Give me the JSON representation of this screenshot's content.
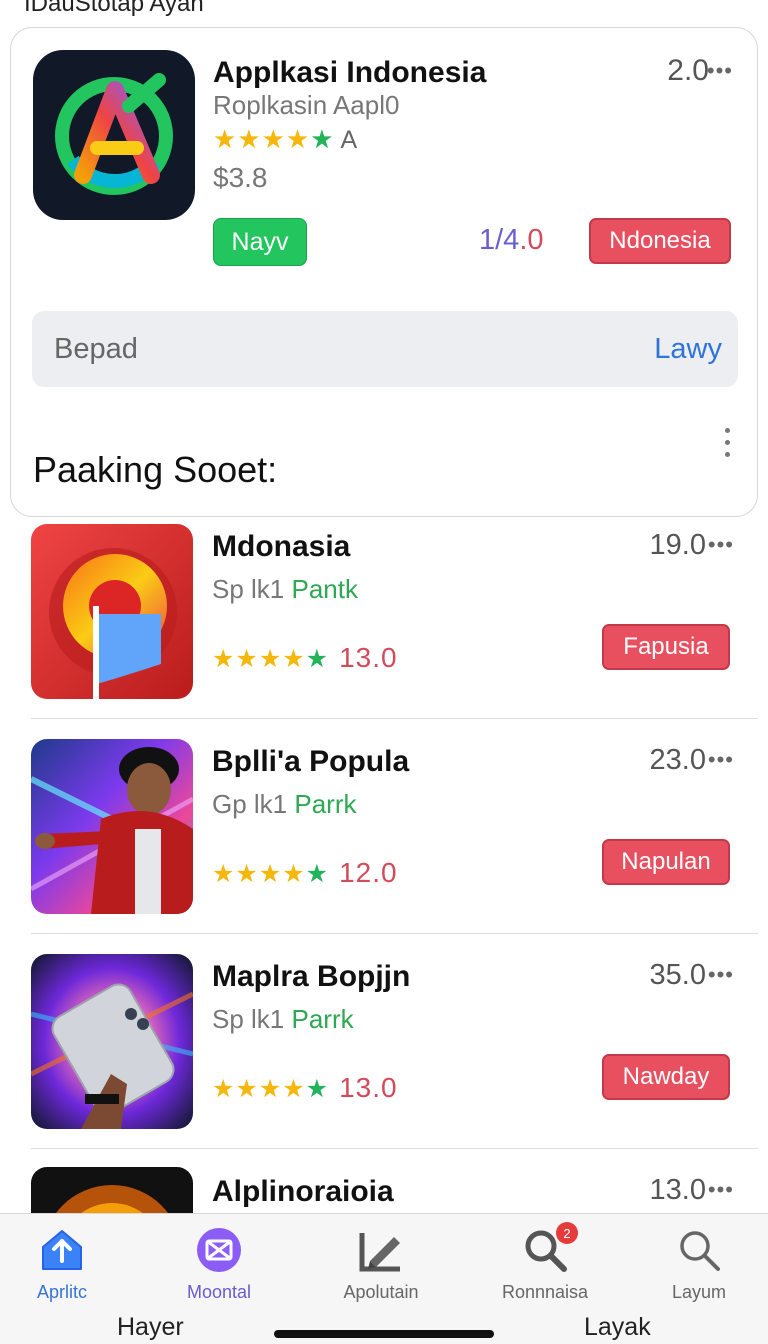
{
  "top": {
    "cut_title": "IDauStotap Ayan"
  },
  "featured": {
    "title": "Applkasi  Indonesia",
    "subtitle": "Roplkasin Aapl0",
    "star_label": "A",
    "price": "$3.8",
    "rank": "2.0",
    "primary_button": "Nayv",
    "ratio_a": "1/4",
    "ratio_b": ".0",
    "badge": "Ndonesia",
    "icon": "app-logo-a-icon"
  },
  "search": {
    "placeholder": "Bepad",
    "action": "Lawy"
  },
  "section": {
    "title": "Paaking Sooet:"
  },
  "list": [
    {
      "name": "Mdonasia",
      "sub_gray": "Sp lk1 ",
      "sub_green": "Pantk",
      "rank": "19.0",
      "rating": "13.0",
      "tag": "Fapusia"
    },
    {
      "name": "Bplli'a Popula",
      "sub_gray": "Gp lk1 ",
      "sub_green": "Parrk",
      "rank": "23.0",
      "rating": "12.0",
      "tag": "Napulan"
    },
    {
      "name": "Maplra Bopjjn",
      "sub_gray": "Sp lk1 ",
      "sub_green": "Parrk",
      "rank": "35.0",
      "rating": "13.0",
      "tag": "Nawday"
    },
    {
      "name": "Alplinoraioia",
      "rank": "13.0"
    }
  ],
  "tabs": [
    {
      "label": "Aprlitc",
      "icon": "upload-icon"
    },
    {
      "label": "Moontal",
      "icon": "envelope-icon"
    },
    {
      "label": "Apolutain",
      "icon": "edit-icon"
    },
    {
      "label": "Ronnnaisa",
      "icon": "search-notification-icon",
      "badge": "2"
    },
    {
      "label": "Layum",
      "icon": "search-icon"
    }
  ],
  "home_bar": {
    "left": "Hayer",
    "right": "Layak"
  },
  "colors": {
    "accent_blue": "#3574d4",
    "green": "#22c55e",
    "red": "#e9505f",
    "star_yellow": "#f5b70a"
  }
}
